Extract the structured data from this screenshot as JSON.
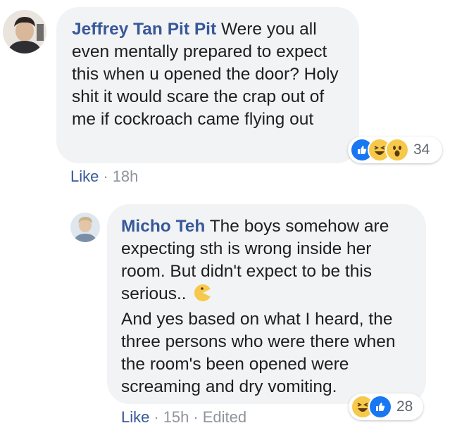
{
  "comments": [
    {
      "author": "Jeffrey Tan Pit Pit",
      "body": " Were you all even mentally prepared to expect this when u opened the door? Holy shit it would scare the crap out of me if cockroach came flying out",
      "like_label": "Like",
      "time": "18h",
      "reaction_icons": [
        "like-icon",
        "haha-icon",
        "wow-icon"
      ],
      "reaction_count": "34"
    },
    {
      "author": "Micho Teh",
      "body": " The boys somehow are expecting sth is wrong inside her room. But didn't expect to be this serious..",
      "body2": "And yes based on what I heard, the three persons who were there when the room's been opened were screaming and dry vomiting.",
      "like_label": "Like",
      "time": "15h",
      "edited_label": "Edited",
      "reaction_icons": [
        "haha-icon",
        "like-icon"
      ],
      "reaction_count": "28"
    }
  ],
  "colors": {
    "author": "#385898",
    "bubble": "#f2f3f5",
    "meta": "#90949c",
    "like_blue": "#1877f2",
    "emoji_yellow": "#f7c94b"
  }
}
